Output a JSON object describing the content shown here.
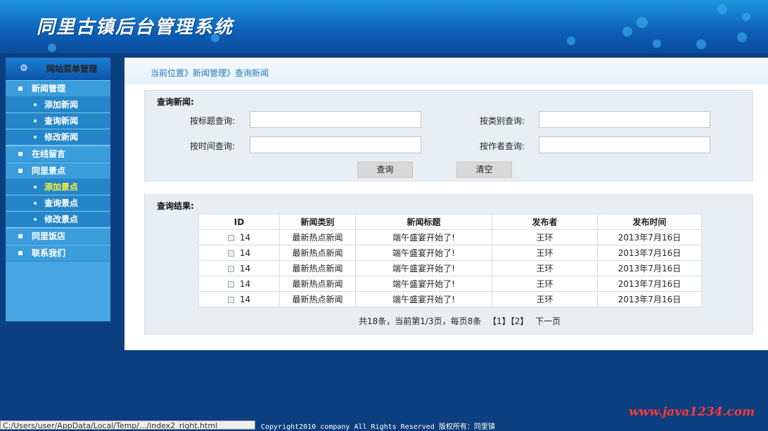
{
  "app_title": "同里古镇后台管理系统",
  "sidebar": {
    "header": "网站菜单管理",
    "items": [
      {
        "label": "新闻管理",
        "type": "main"
      },
      {
        "label": "添加新闻",
        "type": "sub"
      },
      {
        "label": "查询新闻",
        "type": "sub"
      },
      {
        "label": "修改新闻",
        "type": "sub"
      },
      {
        "label": "在线留言",
        "type": "main"
      },
      {
        "label": "同里景点",
        "type": "main"
      },
      {
        "label": "添加景点",
        "type": "sub",
        "active": true
      },
      {
        "label": "查询景点",
        "type": "sub"
      },
      {
        "label": "修改景点",
        "type": "sub"
      },
      {
        "label": "同里饭店",
        "type": "main"
      },
      {
        "label": "联系我们",
        "type": "main"
      }
    ]
  },
  "breadcrumb": "当前位置》新闻管理》查询新闻",
  "search": {
    "title": "查询新闻:",
    "fields": {
      "title_label": "按标题查询:",
      "category_label": "按类别查询:",
      "time_label": "按时间查询:",
      "author_label": "按作者查询:"
    },
    "query_button": "查询",
    "clear_button": "清空"
  },
  "results": {
    "title": "查询结果:",
    "columns": [
      "ID",
      "新闻类别",
      "新闻标题",
      "发布者",
      "发布时间"
    ],
    "rows": [
      {
        "id": "14",
        "category": "最新热点新闻",
        "headline": "端午盛宴开始了!",
        "author": "王环",
        "date": "2013年7月16日"
      },
      {
        "id": "14",
        "category": "最新热点新闻",
        "headline": "端午盛宴开始了!",
        "author": "王环",
        "date": "2013年7月16日"
      },
      {
        "id": "14",
        "category": "最新热点新闻",
        "headline": "端午盛宴开始了!",
        "author": "王环",
        "date": "2013年7月16日"
      },
      {
        "id": "14",
        "category": "最新热点新闻",
        "headline": "端午盛宴开始了!",
        "author": "王环",
        "date": "2013年7月16日"
      },
      {
        "id": "14",
        "category": "最新热点新闻",
        "headline": "端午盛宴开始了!",
        "author": "王环",
        "date": "2013年7月16日"
      }
    ],
    "pager": {
      "summary": "共18条，当前第1/3页，每页8条",
      "pages": [
        "【1】",
        "【2】"
      ],
      "next": "下一页"
    }
  },
  "footer": {
    "status_path": "C:/Users/user/AppData/Local/Temp/.../index2_right.html",
    "copyright": "Copyright2010 company All Rights Reserved  版权所有：同里镇",
    "watermark": "www.java1234.com"
  },
  "colors": {
    "header_blue": "#0d5fb6",
    "sidebar_blue": "#47a6e3",
    "page_bg": "#0c3f7f",
    "active_menu_text": "#ffef3a"
  }
}
